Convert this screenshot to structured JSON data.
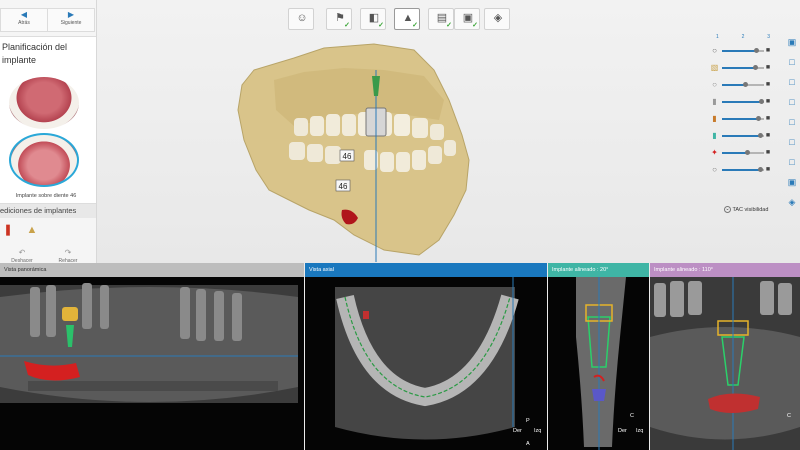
{
  "nav": {
    "back_label": "Atrás",
    "next_label": "Siguiente"
  },
  "panel": {
    "title": "Planificación del implante",
    "caption": "Implante sobre diente 46",
    "section": "ediciones de implantes"
  },
  "history": {
    "undo_label": "Deshacer",
    "redo_label": "Rehacer"
  },
  "toolbar": {
    "buttons": [
      {
        "icon": "doctor-avatar-icon",
        "checked": false,
        "active": false
      },
      {
        "icon": "tooth-select-icon",
        "checked": true,
        "active": false
      },
      {
        "icon": "scan-align-icon",
        "checked": true,
        "active": false
      },
      {
        "icon": "implant-icon",
        "checked": true,
        "active": true
      },
      {
        "icon": "scanner-icon",
        "checked": true,
        "active": false
      },
      {
        "icon": "review-icon",
        "checked": true,
        "active": false
      },
      {
        "icon": "export-icon",
        "checked": false,
        "active": false
      }
    ]
  },
  "model": {
    "label_upper": "46",
    "label_lower": "46"
  },
  "layers": {
    "numbers": [
      "1",
      "2",
      "3"
    ],
    "tac_label": "TAC visibilidad",
    "sliders": [
      {
        "icon": "eye-icon",
        "level": 0.82
      },
      {
        "icon": "jaw-icon",
        "level": 0.78
      },
      {
        "icon": "teeth-icon",
        "level": 0.55
      },
      {
        "icon": "abutment-icon",
        "level": 0.92
      },
      {
        "icon": "implant-layer-icon",
        "level": 0.85
      },
      {
        "icon": "crown-icon",
        "level": 0.9
      },
      {
        "icon": "nerve-icon",
        "level": 0.6
      },
      {
        "icon": "sleeve-icon",
        "level": 0.9
      }
    ]
  },
  "views": {
    "panoramic": {
      "title": "Vista panorámica"
    },
    "axial": {
      "title": "Vista axial"
    },
    "aligned": {
      "title": "Implante alineado : 20°"
    },
    "aligned2": {
      "title": "Implante alineado : 110°"
    },
    "orient": {
      "right": "Der",
      "left": "Izq",
      "posterior": "P",
      "anterior": "A",
      "crown": "C"
    }
  },
  "colors": {
    "accent": "#1a78be",
    "teal": "#3fb5a5",
    "purple": "#bc8fc4",
    "bone": "#d9c48a",
    "check": "#39a535"
  }
}
